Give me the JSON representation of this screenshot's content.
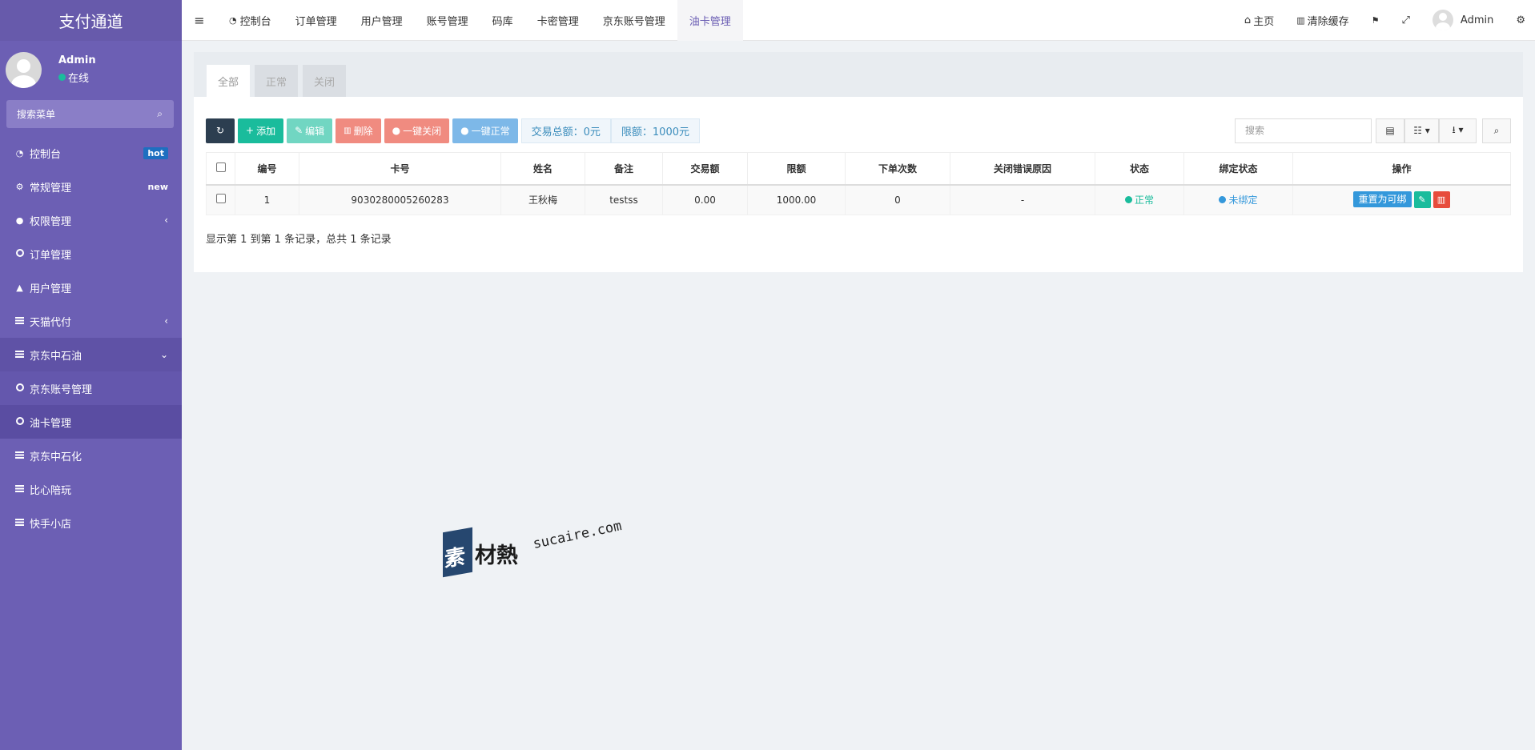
{
  "app": {
    "title": "支付通道"
  },
  "user": {
    "name": "Admin",
    "status": "在线",
    "status_color": "#1abc9c"
  },
  "sidebar": {
    "search_placeholder": "搜索菜单",
    "items": [
      {
        "label": "控制台",
        "icon": "dashboard-icon",
        "badge": "hot"
      },
      {
        "label": "常规管理",
        "icon": "cogs-icon",
        "badge": "new"
      },
      {
        "label": "权限管理",
        "icon": "group-icon"
      },
      {
        "label": "订单管理",
        "icon": "circle-o-icon"
      },
      {
        "label": "用户管理",
        "icon": "user-icon"
      },
      {
        "label": "天猫代付",
        "icon": "list-icon"
      },
      {
        "label": "京东中石油",
        "icon": "list-icon"
      },
      {
        "label": "京东账号管理",
        "icon": "circle-o-icon"
      },
      {
        "label": "油卡管理",
        "icon": "circle-o-icon"
      },
      {
        "label": "京东中石化",
        "icon": "list-icon"
      },
      {
        "label": "比心陪玩",
        "icon": "list-icon"
      },
      {
        "label": "快手小店",
        "icon": "list-icon"
      }
    ]
  },
  "topbar": {
    "tabs": [
      "控制台",
      "订单管理",
      "用户管理",
      "账号管理",
      "码库",
      "卡密管理",
      "京东账号管理",
      "油卡管理"
    ],
    "right": {
      "home": "主页",
      "clear_cache": "清除缓存",
      "user": "Admin"
    }
  },
  "panel": {
    "tabs": [
      "全部",
      "正常",
      "关闭"
    ],
    "toolbar": {
      "add": "添加",
      "edit": "编辑",
      "delete": "删除",
      "close_all": "一键关闭",
      "normal_all": "一键正常",
      "total_amount": "交易总额：0元",
      "limit": "限额：1000元",
      "search_placeholder": "搜索"
    },
    "table": {
      "headers": [
        "编号",
        "卡号",
        "姓名",
        "备注",
        "交易额",
        "限额",
        "下单次数",
        "关闭错误原因",
        "状态",
        "绑定状态",
        "操作"
      ],
      "rows": [
        {
          "id": "1",
          "card": "9030280005260283",
          "name": "王秋梅",
          "remark": "testss",
          "amount": "0.00",
          "limit": "1000.00",
          "orders": "0",
          "reason": "-",
          "status": "正常",
          "bind": "未绑定",
          "action": "重置为可绑"
        }
      ]
    },
    "pager": "显示第 1 到第 1 条记录，总共 1 条记录"
  },
  "watermark": {
    "name": "素材熱",
    "logo_char": "素",
    "logo_rest": "材熱",
    "url": "sucaire.com"
  },
  "colors": {
    "sidebar": "#6c5fb4",
    "accent": "#6c5fb4",
    "green": "#1abc9c",
    "blue": "#3498db",
    "red": "#e74c3c"
  }
}
